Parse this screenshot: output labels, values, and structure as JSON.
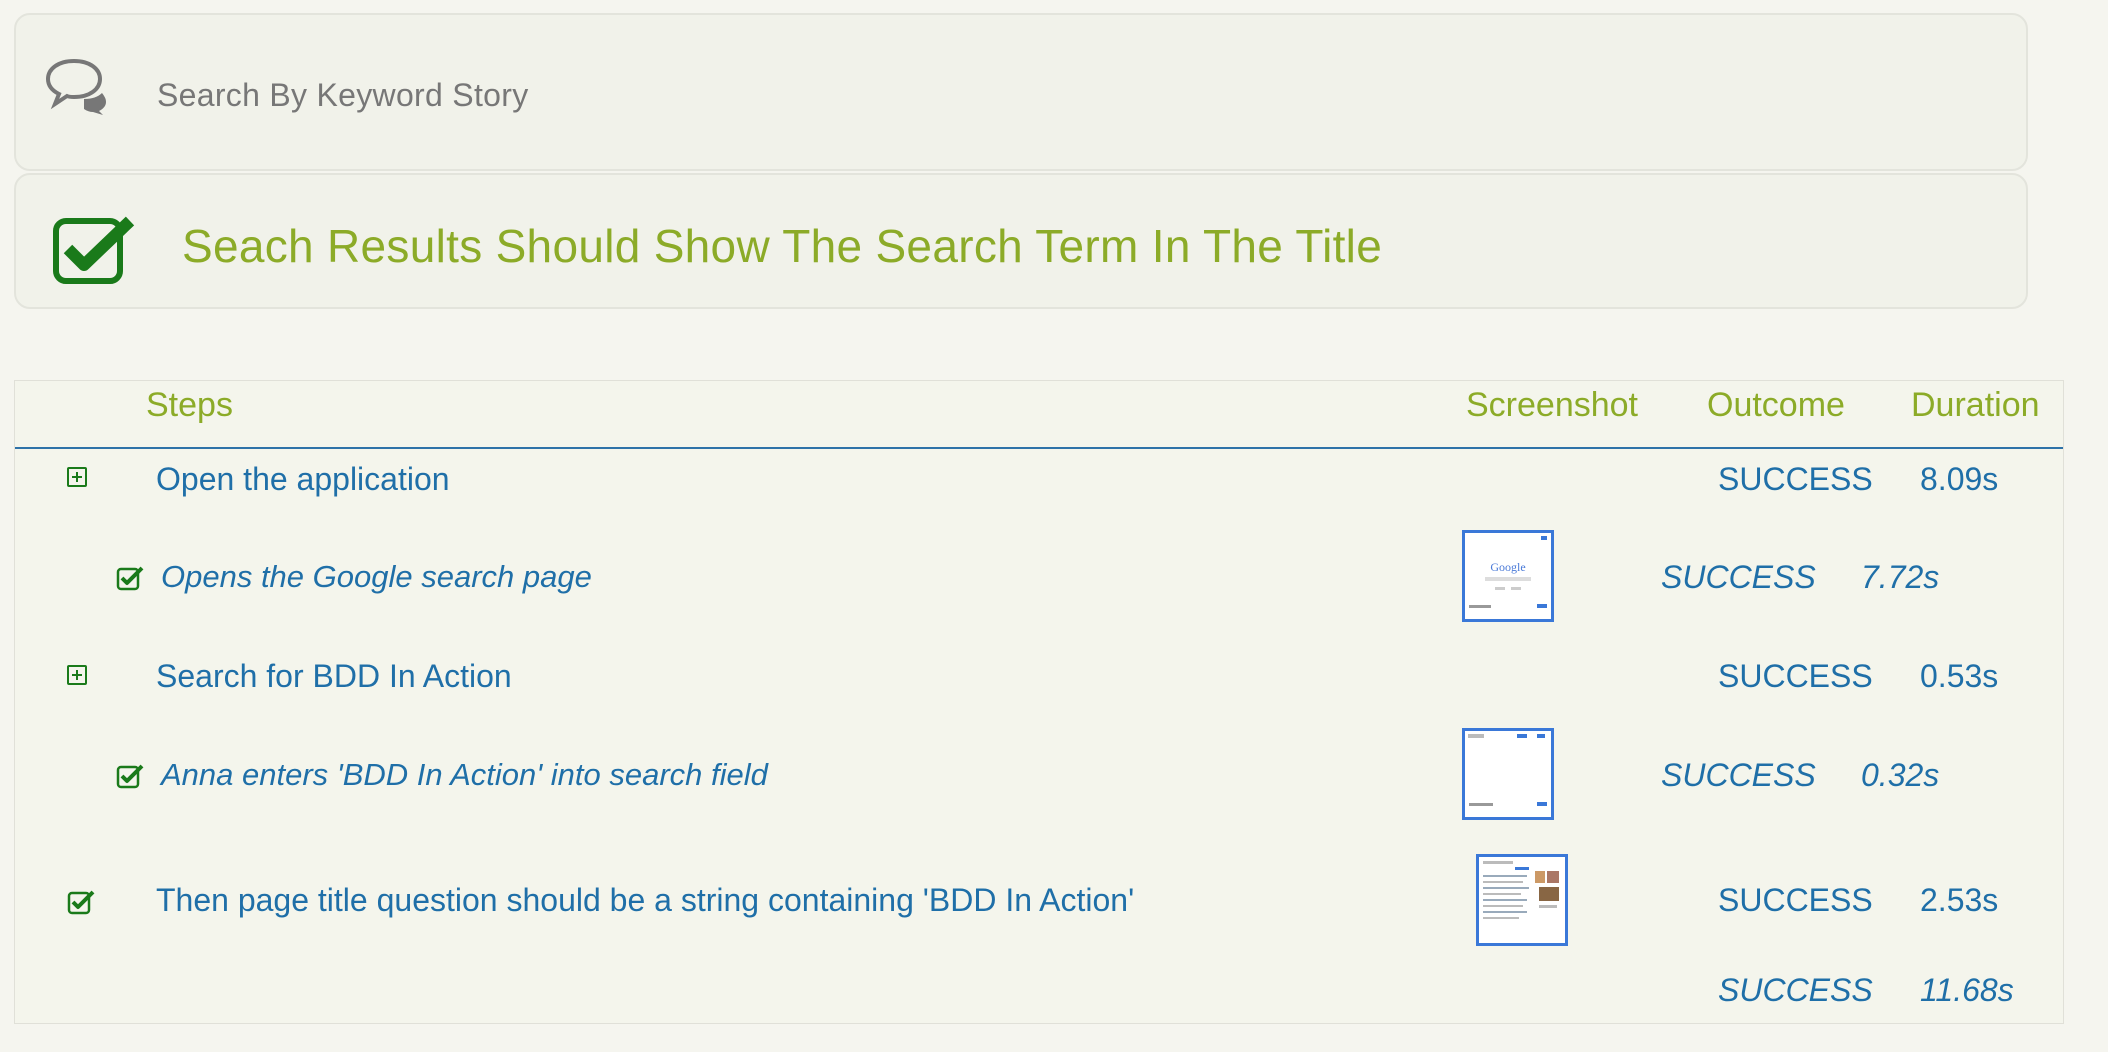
{
  "story": {
    "icon": "speech-bubbles-icon",
    "title": "Search By Keyword Story"
  },
  "scenario": {
    "icon": "checked-box-icon",
    "title": "Seach Results Should Show The Search Term In The Title",
    "accent_color": "#8cab28"
  },
  "table": {
    "headers": {
      "steps": "Steps",
      "screenshot": "Screenshot",
      "outcome": "Outcome",
      "duration": "Duration"
    },
    "rows": [
      {
        "text": "Open the application",
        "outcome": "SUCCESS",
        "duration": "8.09s",
        "icon": "expand-icon",
        "screenshot": false
      },
      {
        "text": "Opens the Google search page",
        "outcome": "SUCCESS",
        "duration": "7.72s",
        "icon": "check-icon",
        "screenshot": true
      },
      {
        "text": "Search for BDD In Action",
        "outcome": "SUCCESS",
        "duration": "0.53s",
        "icon": "expand-icon",
        "screenshot": false
      },
      {
        "text": "Anna enters 'BDD In Action' into search field",
        "outcome": "SUCCESS",
        "duration": "0.32s",
        "icon": "check-icon",
        "screenshot": true
      },
      {
        "text": "Then page title question should be a string containing 'BDD In Action'",
        "outcome": "SUCCESS",
        "duration": "2.53s",
        "icon": "check-icon",
        "screenshot": true
      }
    ],
    "total": {
      "outcome": "SUCCESS",
      "duration": "11.68s"
    }
  },
  "colors": {
    "link": "#1f6fa8",
    "success_green": "#1a7a1a",
    "header_rule": "#2e72a8"
  }
}
